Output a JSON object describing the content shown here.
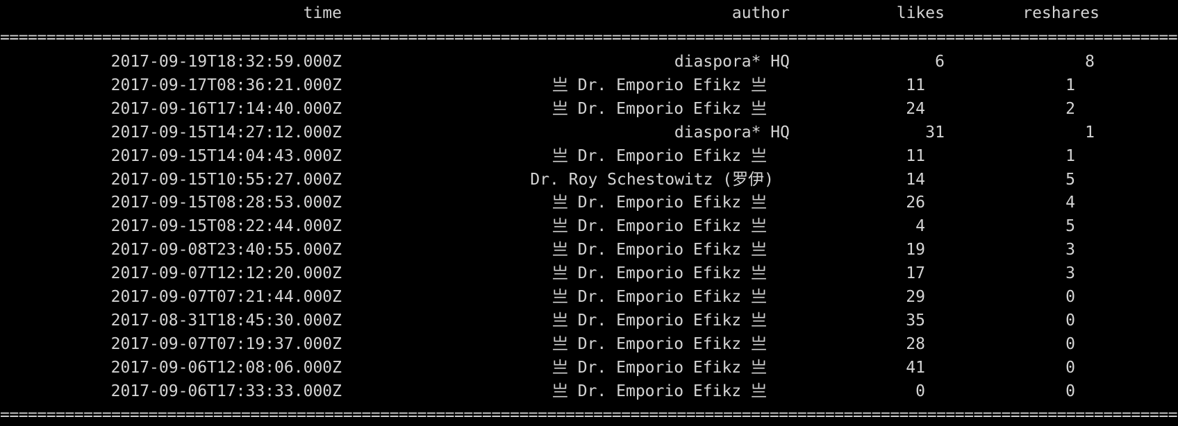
{
  "table": {
    "headers": {
      "time": "time",
      "author": "author",
      "likes": "likes",
      "reshares": "reshares"
    },
    "separator_char": "=",
    "rows": [
      {
        "time": "2017-09-19T18:32:59.000Z",
        "author": "diaspora* HQ",
        "likes": "6",
        "reshares": "8"
      },
      {
        "time": "2017-09-17T08:36:21.000Z",
        "author": "亗 Dr. Emporio Efikz 亗",
        "likes": "11",
        "reshares": "1"
      },
      {
        "time": "2017-09-16T17:14:40.000Z",
        "author": "亗 Dr. Emporio Efikz 亗",
        "likes": "24",
        "reshares": "2"
      },
      {
        "time": "2017-09-15T14:27:12.000Z",
        "author": "diaspora* HQ",
        "likes": "31",
        "reshares": "1"
      },
      {
        "time": "2017-09-15T14:04:43.000Z",
        "author": "亗 Dr. Emporio Efikz 亗",
        "likes": "11",
        "reshares": "1"
      },
      {
        "time": "2017-09-15T10:55:27.000Z",
        "author": "Dr. Roy Schestowitz (罗伊)",
        "likes": "14",
        "reshares": "5"
      },
      {
        "time": "2017-09-15T08:28:53.000Z",
        "author": "亗 Dr. Emporio Efikz 亗",
        "likes": "26",
        "reshares": "4"
      },
      {
        "time": "2017-09-15T08:22:44.000Z",
        "author": "亗 Dr. Emporio Efikz 亗",
        "likes": "4",
        "reshares": "5"
      },
      {
        "time": "2017-09-08T23:40:55.000Z",
        "author": "亗 Dr. Emporio Efikz 亗",
        "likes": "19",
        "reshares": "3"
      },
      {
        "time": "2017-09-07T12:12:20.000Z",
        "author": "亗 Dr. Emporio Efikz 亗",
        "likes": "17",
        "reshares": "3"
      },
      {
        "time": "2017-09-07T07:21:44.000Z",
        "author": "亗 Dr. Emporio Efikz 亗",
        "likes": "29",
        "reshares": "0"
      },
      {
        "time": "2017-08-31T18:45:30.000Z",
        "author": "亗 Dr. Emporio Efikz 亗",
        "likes": "35",
        "reshares": "0"
      },
      {
        "time": "2017-09-07T07:19:37.000Z",
        "author": "亗 Dr. Emporio Efikz 亗",
        "likes": "28",
        "reshares": "0"
      },
      {
        "time": "2017-09-06T12:08:06.000Z",
        "author": "亗 Dr. Emporio Efikz 亗",
        "likes": "41",
        "reshares": "0"
      },
      {
        "time": "2017-09-06T17:33:33.000Z",
        "author": "亗 Dr. Emporio Efikz 亗",
        "likes": "0",
        "reshares": "0"
      }
    ]
  }
}
